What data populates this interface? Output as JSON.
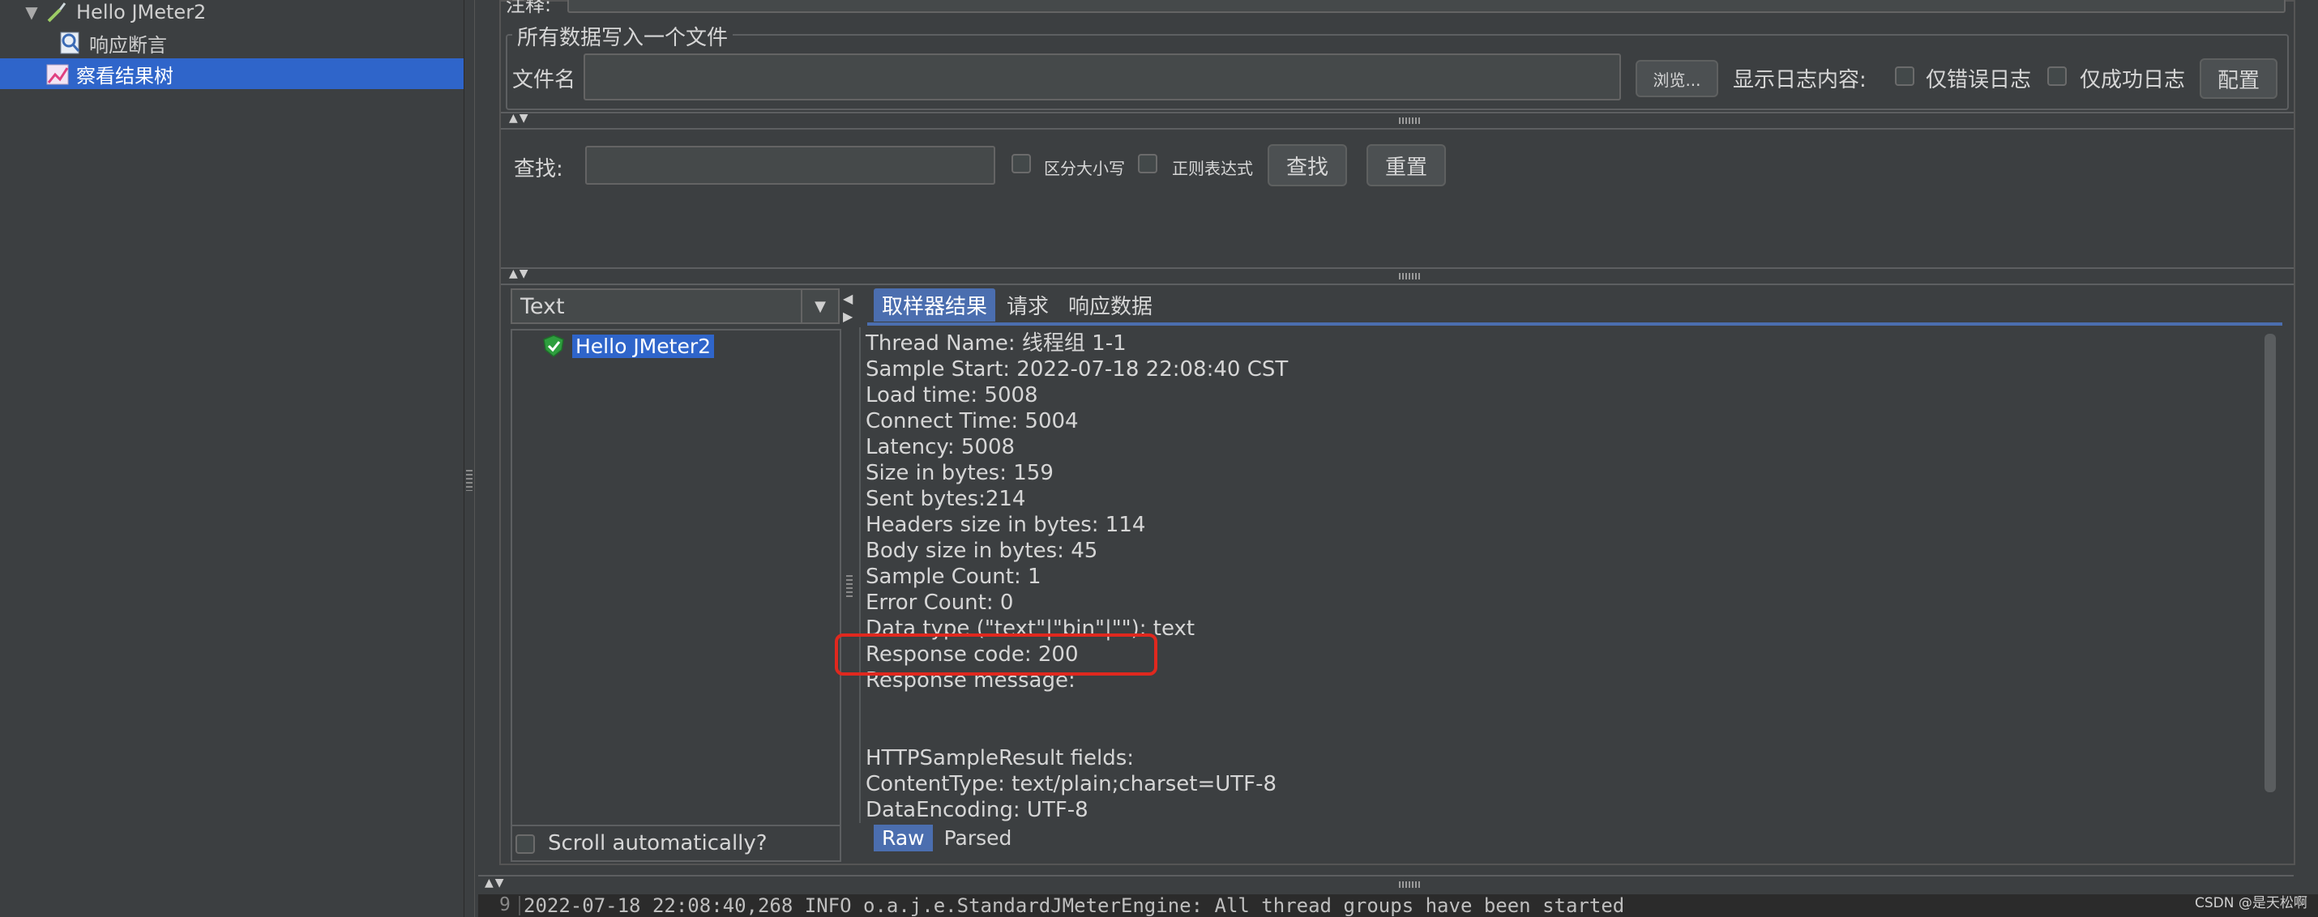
{
  "tree": {
    "items": [
      {
        "label": "Hello JMeter2",
        "icon": "dropper-icon",
        "expanded": true
      },
      {
        "label": "响应断言",
        "icon": "magnifier-assertion-icon"
      },
      {
        "label": "察看结果树",
        "icon": "chart-listener-icon",
        "selected": true
      }
    ]
  },
  "header": {
    "comment_label": "注释:"
  },
  "file_section": {
    "legend": "所有数据写入一个文件",
    "filename_label": "文件名",
    "filename_value": "",
    "browse_button": "浏览...",
    "log_display_label": "显示日志内容:",
    "errors_only_label": "仅错误日志",
    "success_only_label": "仅成功日志",
    "config_button": "配置"
  },
  "search": {
    "label": "查找:",
    "value": "",
    "case_sensitive_label": "区分大小写",
    "regex_label": "正则表达式",
    "find_button": "查找",
    "reset_button": "重置"
  },
  "renderer": {
    "selected": "Text"
  },
  "results_tree": {
    "items": [
      {
        "label": "Hello JMeter2",
        "status": "success"
      }
    ]
  },
  "scroll_auto_label": "Scroll automatically?",
  "tabs": [
    "取样器结果",
    "请求",
    "响应数据"
  ],
  "sampler_result": {
    "lines": [
      "Thread Name: 线程组 1-1",
      "Sample Start: 2022-07-18 22:08:40 CST",
      "Load time: 5008",
      "Connect Time: 5004",
      "Latency: 5008",
      "Size in bytes: 159",
      "Sent bytes:214",
      "Headers size in bytes: 114",
      "Body size in bytes: 45",
      "Sample Count: 1",
      "Error Count: 0",
      "Data type (\"text\"|\"bin\"|\"\"): text",
      "Response code: 200",
      "Response message: ",
      "",
      "",
      "HTTPSampleResult fields:",
      "ContentType: text/plain;charset=UTF-8",
      "DataEncoding: UTF-8"
    ]
  },
  "bottom_tabs": [
    "Raw",
    "Parsed"
  ],
  "log": {
    "line_number": "9",
    "text": "2022-07-18 22:08:40,268 INFO o.a.j.e.StandardJMeterEngine: All thread groups have been started"
  },
  "watermark": "CSDN @是天松啊",
  "colors": {
    "selection": "#2f65ca",
    "tab_active": "#4b6eaf",
    "highlight": "#e0281e",
    "success": "#2e9e3e"
  }
}
